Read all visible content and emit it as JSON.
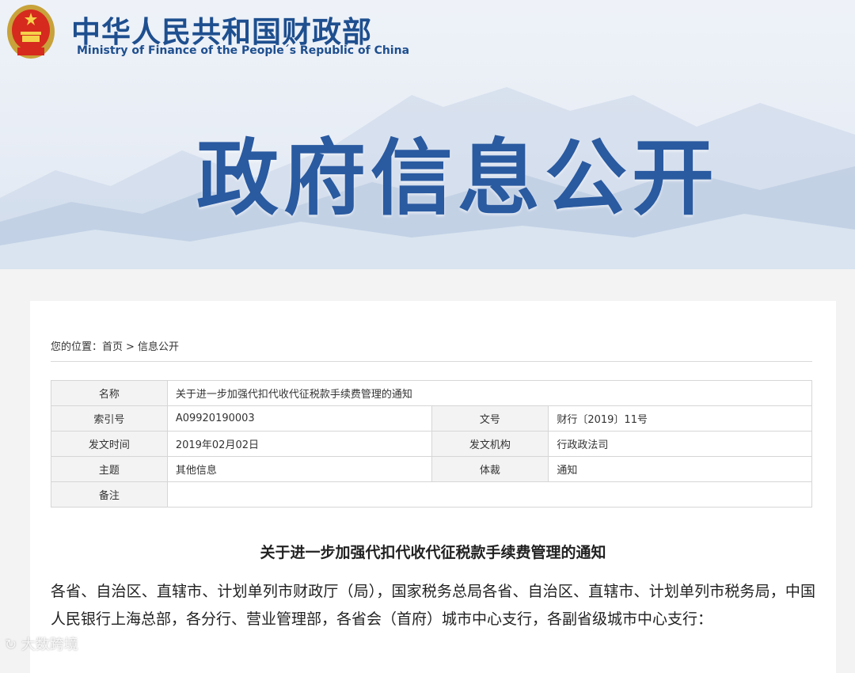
{
  "header": {
    "site_name_cn": "中华人民共和国财政部",
    "site_name_en": "Ministry of Finance of the People´s Republic of China",
    "banner_title": "政府信息公开"
  },
  "breadcrumb": {
    "prefix": "您的位置：",
    "home": "首页",
    "separator": ">",
    "current": "信息公开"
  },
  "meta": {
    "name_label": "名称",
    "name_value": "关于进一步加强代扣代收代征税款手续费管理的通知",
    "index_label": "索引号",
    "index_value": "A09920190003",
    "docno_label": "文号",
    "docno_value": "财行〔2019〕11号",
    "date_label": "发文时间",
    "date_value": "2019年02月02日",
    "issuer_label": "发文机构",
    "issuer_value": "行政政法司",
    "topic_label": "主题",
    "topic_value": "其他信息",
    "genre_label": "体裁",
    "genre_value": "通知",
    "remark_label": "备注",
    "remark_value": ""
  },
  "document": {
    "title": "关于进一步加强代扣代收代征税款手续费管理的通知",
    "body": "各省、自治区、直辖市、计划单列市财政厅（局），国家税务总局各省、自治区、直辖市、计划单列市税务局，中国人民银行上海总部，各分行、营业管理部，各省会（首府）城市中心支行，各副省级城市中心支行："
  },
  "watermark": "大数跨境",
  "colors": {
    "brand_blue": "#1e4f8f",
    "banner_title": "#2a5aa0"
  }
}
